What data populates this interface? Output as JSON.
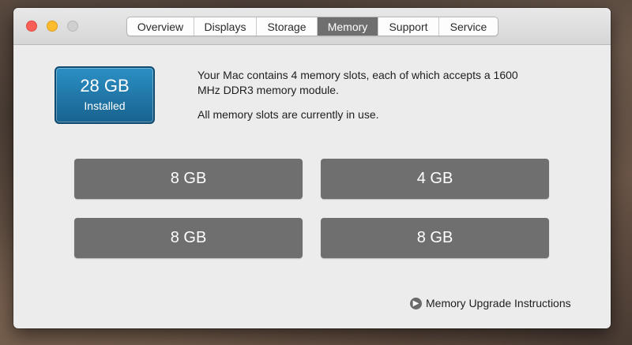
{
  "window": {
    "tabs": [
      {
        "label": "Overview"
      },
      {
        "label": "Displays"
      },
      {
        "label": "Storage"
      },
      {
        "label": "Memory"
      },
      {
        "label": "Support"
      },
      {
        "label": "Service"
      }
    ],
    "active_tab": "Memory"
  },
  "memory": {
    "installed_size": "28 GB",
    "installed_label": "Installed",
    "description_line1": "Your Mac contains 4 memory slots, each of which accepts a 1600 MHz DDR3 memory module.",
    "description_line2": "All memory slots are currently in use.",
    "slots": [
      {
        "size": "8 GB"
      },
      {
        "size": "4 GB"
      },
      {
        "size": "8 GB"
      },
      {
        "size": "8 GB"
      }
    ],
    "upgrade_link": "Memory Upgrade Instructions"
  },
  "icons": {
    "upgrade_link_icon": "arrow-right-circle-icon"
  }
}
